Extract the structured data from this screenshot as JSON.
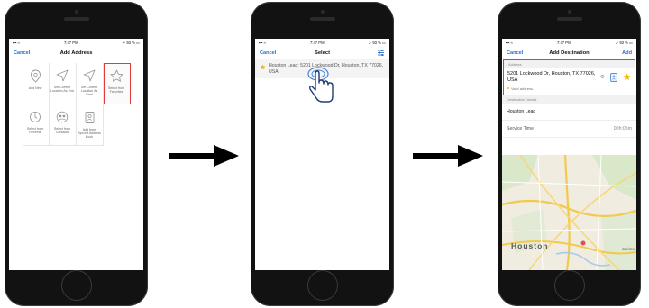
{
  "phone1": {
    "status": {
      "time": "7:47 PM",
      "battery": "93 %"
    },
    "nav": {
      "cancel": "Cancel",
      "title": "Add Address"
    },
    "tiles": [
      {
        "label": "Add New",
        "icon": "location-pin-icon"
      },
      {
        "label": "Set Current Location As End",
        "icon": "navigation-arrow-icon"
      },
      {
        "label": "Set Current Location As Start",
        "icon": "navigation-arrow-icon"
      },
      {
        "label": "Select from Favorites",
        "icon": "star-icon"
      },
      {
        "label": "Select from Recents",
        "icon": "history-icon"
      },
      {
        "label": "Select from Contacts",
        "icon": "contacts-icon"
      },
      {
        "label": "Add from Synced Address Book",
        "icon": "address-book-icon"
      }
    ]
  },
  "phone2": {
    "status": {
      "time": "7:47 PM",
      "battery": "93 %"
    },
    "nav": {
      "cancel": "Cancel",
      "title": "Select"
    },
    "favorite": {
      "text": "Houston Lead: 5201 Lockwood Dr, Houston, TX 77026, USA"
    }
  },
  "phone3": {
    "status": {
      "time": "7:47 PM",
      "battery": "93 %"
    },
    "nav": {
      "cancel": "Cancel",
      "title": "Add Destination",
      "add": "Add"
    },
    "address_header": "Address",
    "address": "5201 Lockwood Dr, Houston, TX 77026, USA",
    "valid": "Valid address.",
    "details_header": "Destination Details",
    "name": "Houston Lead",
    "service_label": "Service Time",
    "service_value": "00h:05m",
    "map_city": "Houston",
    "map_label_right": "Jacinto"
  },
  "colors": {
    "accent": "#2a6fd1",
    "highlight": "#e03a3a",
    "star": "#f4b400"
  }
}
